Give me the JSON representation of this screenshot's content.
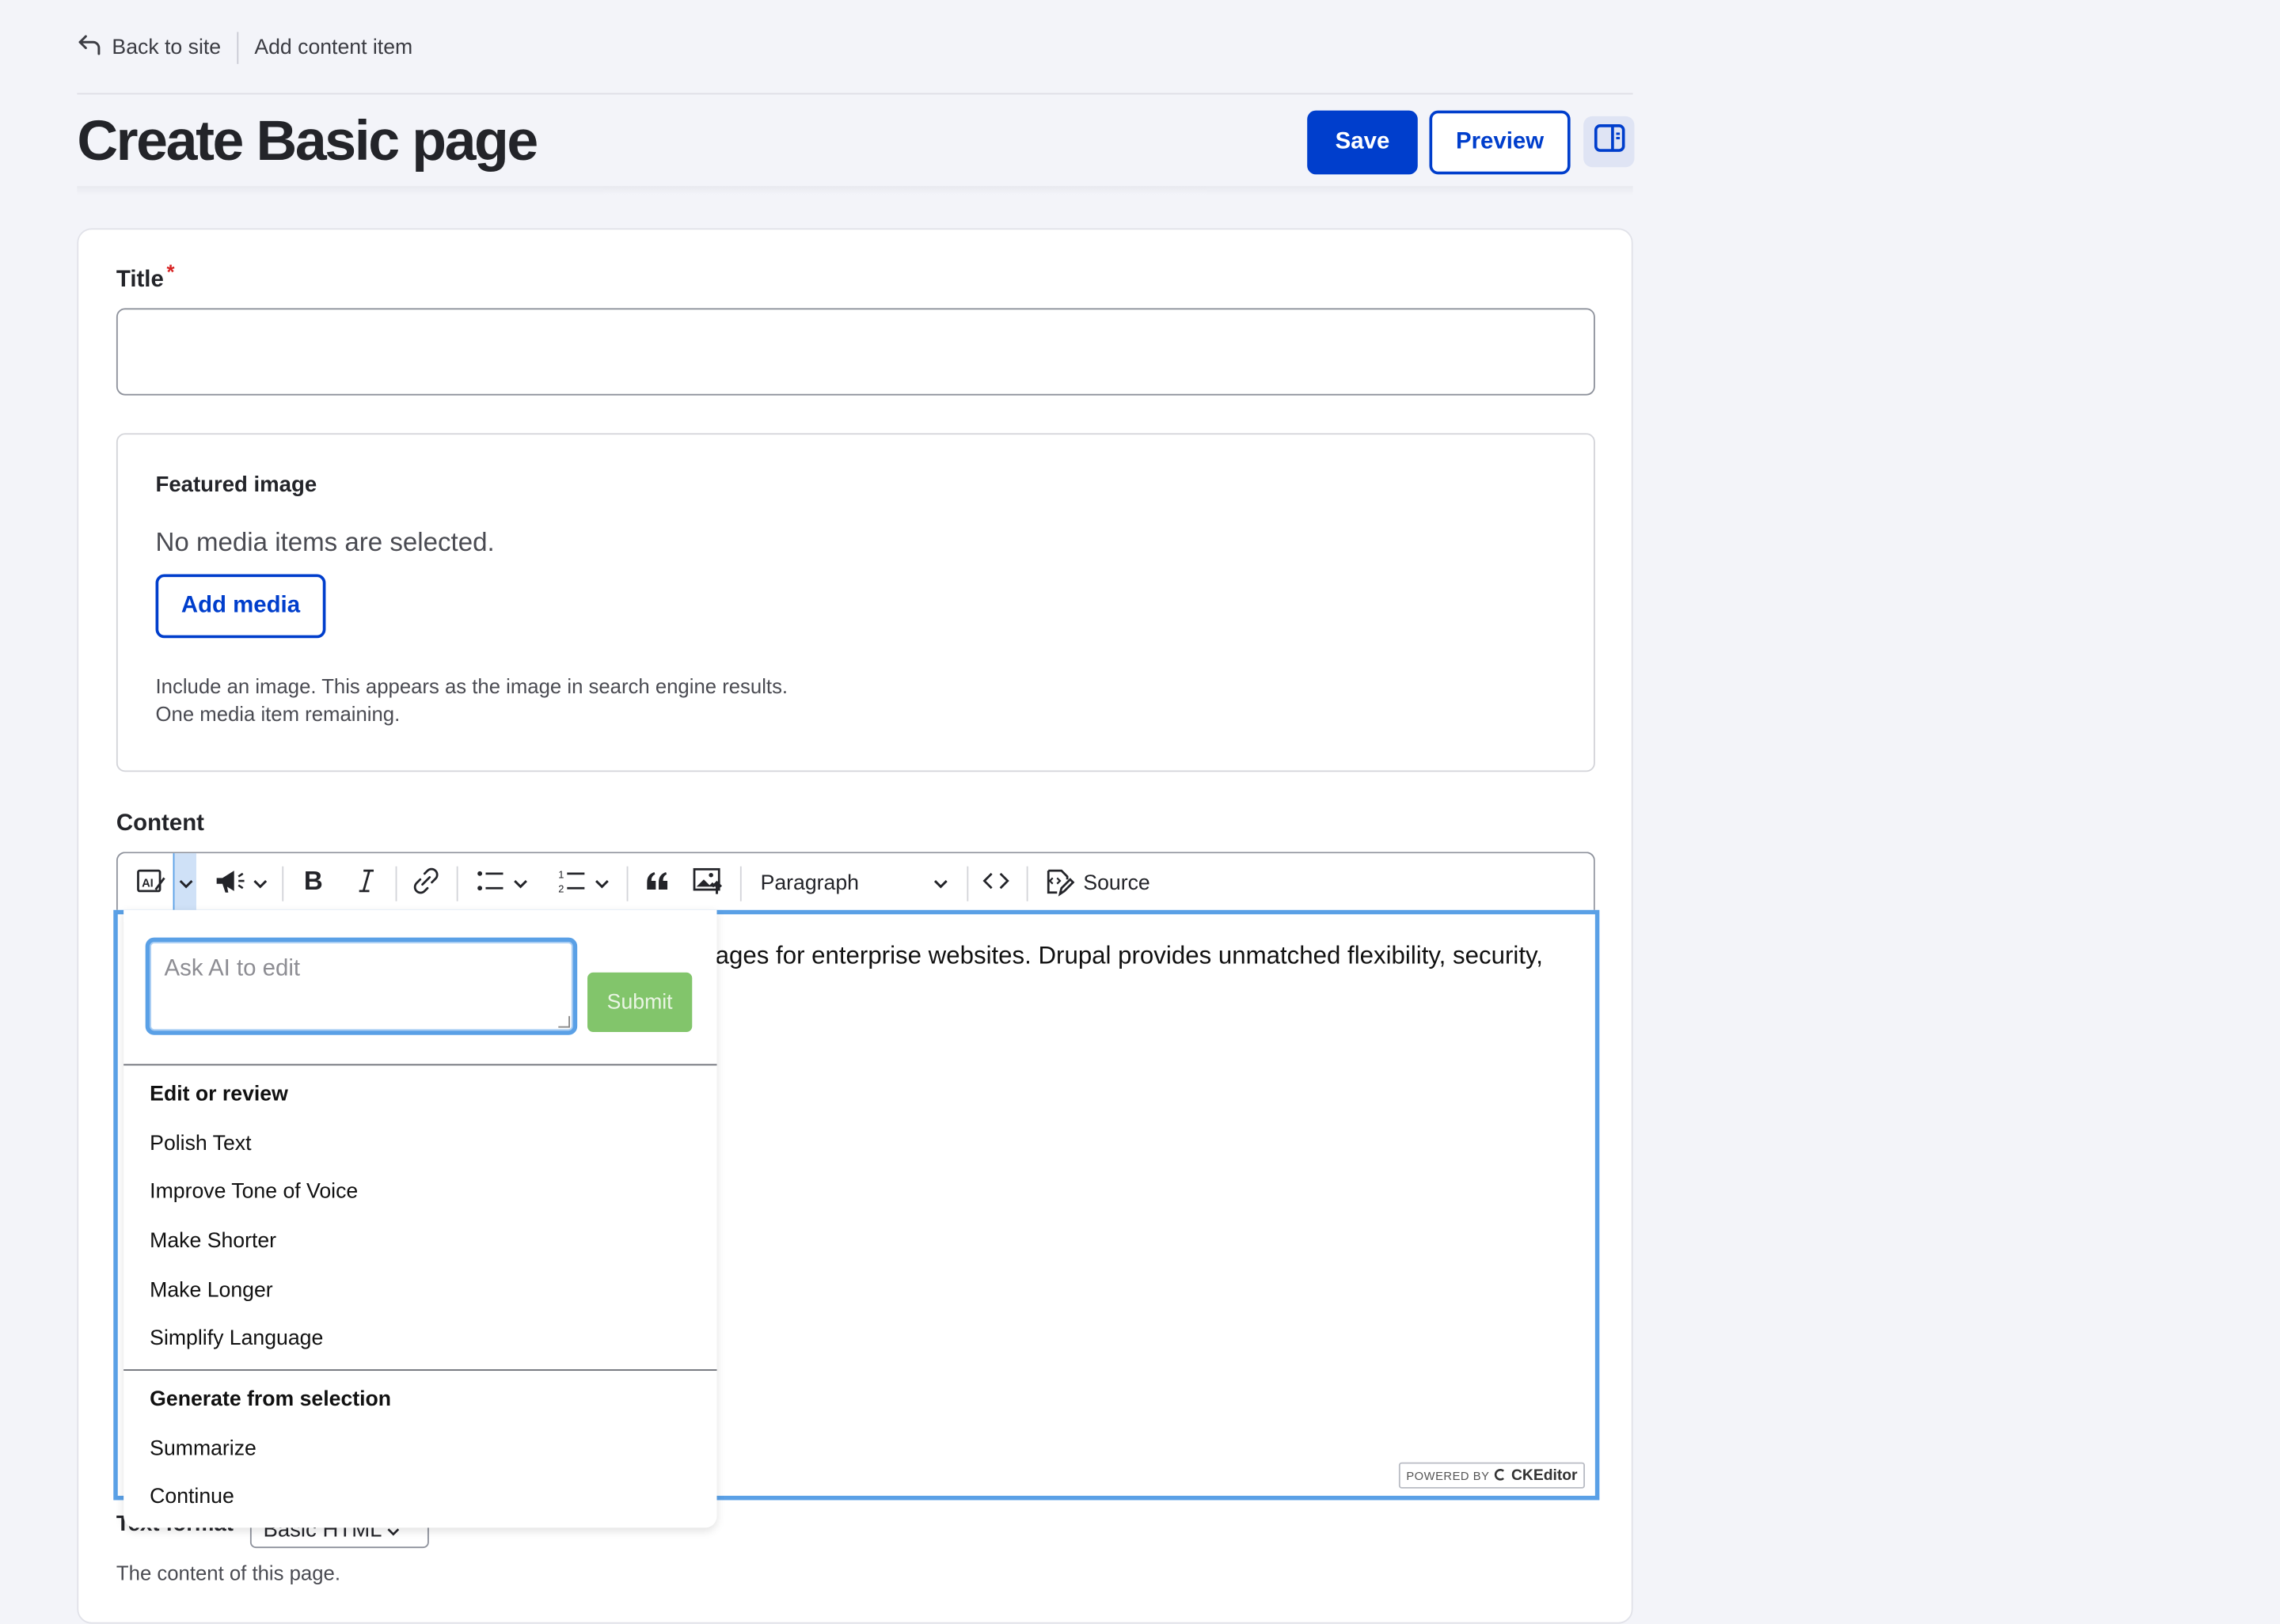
{
  "topnav": {
    "back_label": "Back to site",
    "breadcrumb": "Add content item"
  },
  "header": {
    "title": "Create Basic page",
    "save_label": "Save",
    "preview_label": "Preview"
  },
  "form": {
    "title_label": "Title",
    "title_required_mark": "*",
    "title_value": "",
    "featured_image": {
      "legend": "Featured image",
      "empty_message": "No media items are selected.",
      "add_media_label": "Add media",
      "description_line1": "Include an image. This appears as the image in search engine results.",
      "description_line2": "One media item remaining."
    },
    "content_label": "Content",
    "text_format_label": "Text format",
    "text_format_value": "Basic HTML",
    "content_description": "The content of this page."
  },
  "editor": {
    "visible_text": "ages for enterprise websites. Drupal provides unmatched flexibility, security,",
    "toolbar": {
      "heading_select": "Paragraph",
      "source_label": "Source"
    },
    "badge_prefix": "POWERED BY",
    "badge_brand": "CKEditor"
  },
  "ai_menu": {
    "input_placeholder": "Ask AI to edit",
    "submit_label": "Submit",
    "groups": [
      {
        "heading": "Edit or review",
        "items": [
          "Polish Text",
          "Improve Tone of Voice",
          "Make Shorter",
          "Make Longer",
          "Simplify Language"
        ]
      },
      {
        "heading": "Generate from selection",
        "items": [
          "Summarize",
          "Continue"
        ]
      }
    ]
  },
  "colors": {
    "primary": "#003ecc",
    "focus": "#5aa0e6",
    "submit": "#82c56b",
    "required": "#d72222",
    "background": "#f3f4f9"
  },
  "icons": [
    "back-arrow-icon",
    "sidebar-toggle-icon",
    "ai-icon",
    "chevron-down-icon",
    "megaphone-icon",
    "bold-icon",
    "italic-icon",
    "link-icon",
    "bulleted-list-icon",
    "numbered-list-icon",
    "blockquote-icon",
    "insert-image-icon",
    "code-icon",
    "source-icon",
    "ckeditor-logo-icon"
  ]
}
